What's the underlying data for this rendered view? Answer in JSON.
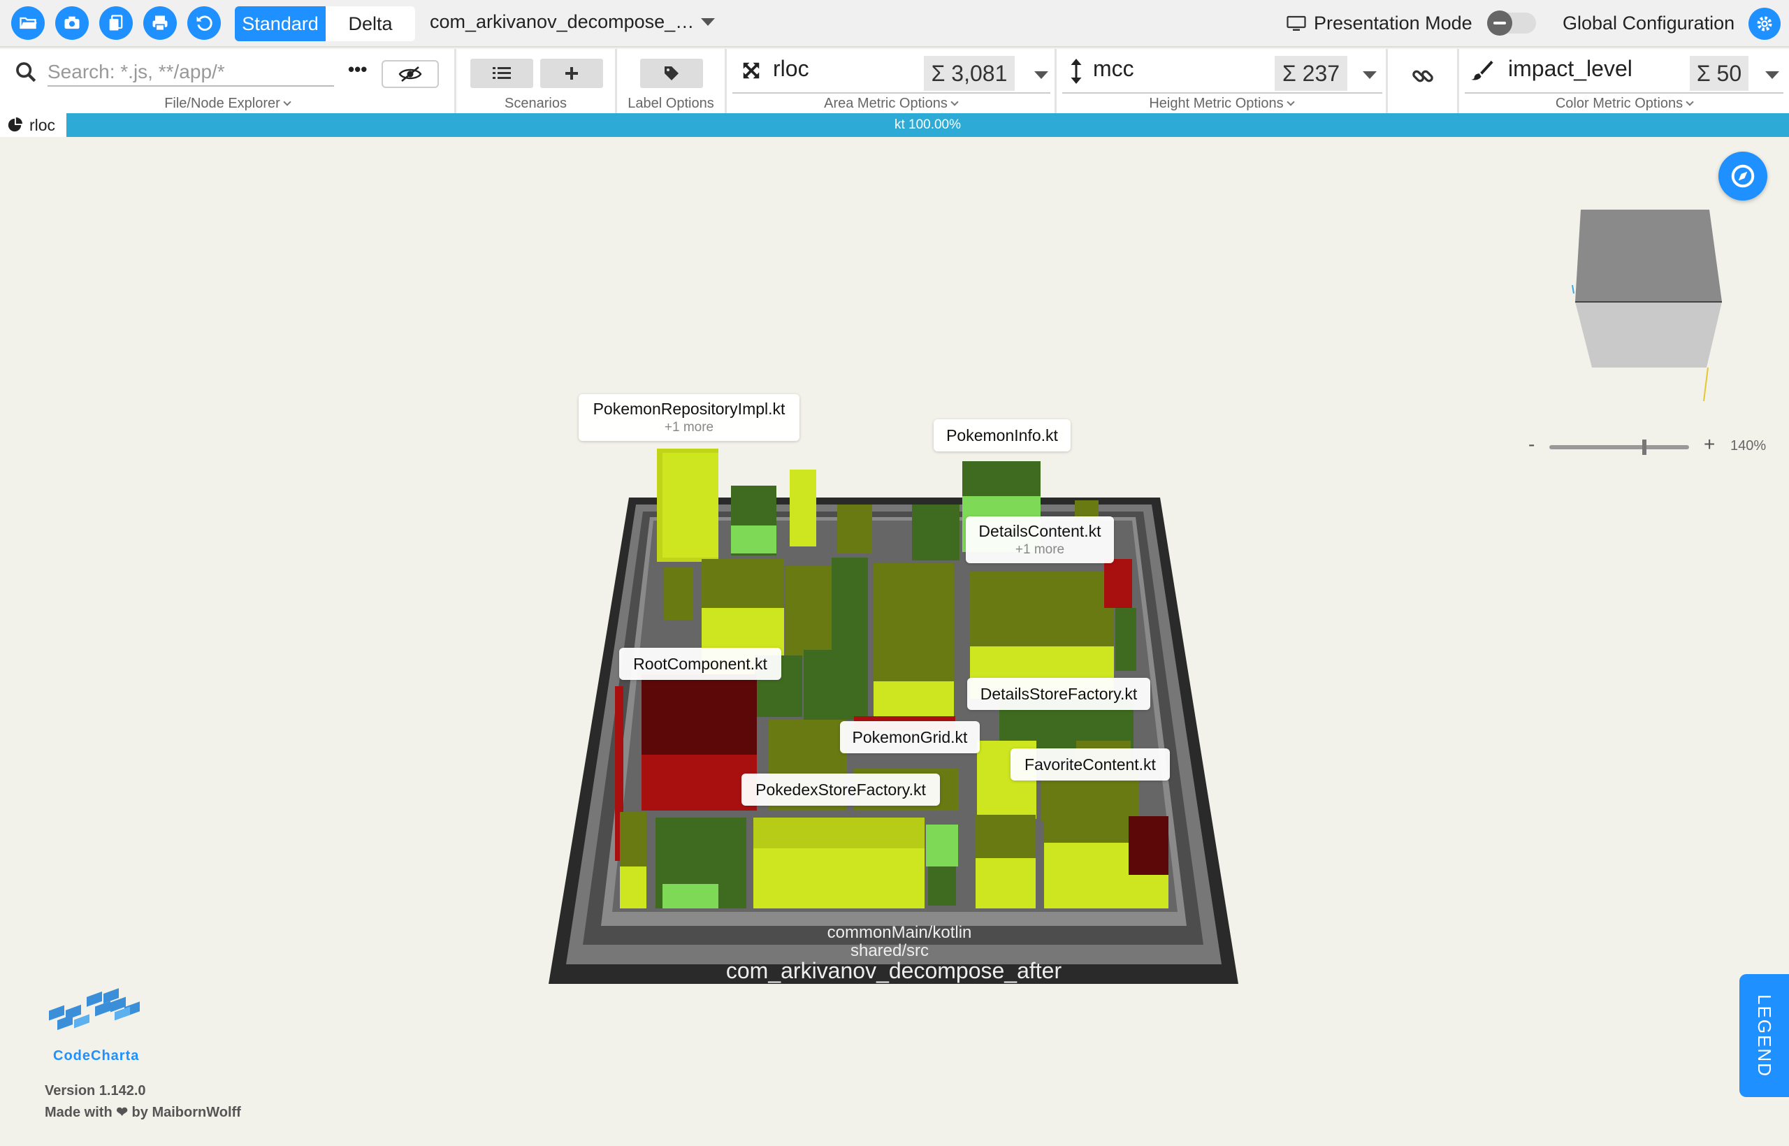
{
  "toolbar": {
    "mode_standard": "Standard",
    "mode_delta": "Delta",
    "selected_file": "com_arkivanov_decompose_…",
    "presentation_mode": "Presentation Mode",
    "global_configuration": "Global Configuration",
    "icons": [
      "folder-open-icon",
      "camera-icon",
      "copy-icon",
      "print-icon",
      "reset-icon",
      "gear-icon"
    ]
  },
  "ribbon": {
    "search_placeholder": "Search: *.js, **/app/*",
    "file_explorer_label": "File/Node Explorer",
    "scenarios_label": "Scenarios",
    "label_options_label": "Label Options",
    "area": {
      "metric": "rloc",
      "sum": "Σ 3,081",
      "label": "Area Metric Options"
    },
    "height": {
      "metric": "mcc",
      "sum": "Σ 237",
      "label": "Height Metric Options"
    },
    "color": {
      "metric": "impact_level",
      "sum": "Σ 50",
      "label": "Color Metric Options"
    }
  },
  "progress": {
    "tab_label": "rloc",
    "text": "kt 100.00%",
    "value": 1.0,
    "color": "#2eaad6"
  },
  "zoom": {
    "minus": "-",
    "plus": "+",
    "value": "140%",
    "level": 1.4
  },
  "legend_tab": "LEGEND",
  "map": {
    "folder_labels": [
      "commonMain/kotlin",
      "shared/src",
      "com_arkivanov_decompose_after"
    ],
    "labels": [
      {
        "name": "PokemonRepositoryImpl.kt",
        "more": "+1 more"
      },
      {
        "name": "PokemonInfo.kt"
      },
      {
        "name": "DetailsContent.kt",
        "more": "+1 more"
      },
      {
        "name": "RootComponent.kt"
      },
      {
        "name": "DetailsStoreFactory.kt"
      },
      {
        "name": "PokemonGrid.kt"
      },
      {
        "name": "FavoriteContent.kt"
      },
      {
        "name": "PokedexStoreFactory.kt"
      }
    ],
    "colors": {
      "positive": "#cde61f",
      "neutral": "#6a7a12",
      "green": "#3f6b20",
      "light_green": "#7ed957",
      "negative": "#a81010"
    }
  },
  "footer": {
    "app_name": "CodeCharta",
    "version": "Version 1.142.0",
    "made_with": "Made with ❤ by MaibornWolff"
  }
}
